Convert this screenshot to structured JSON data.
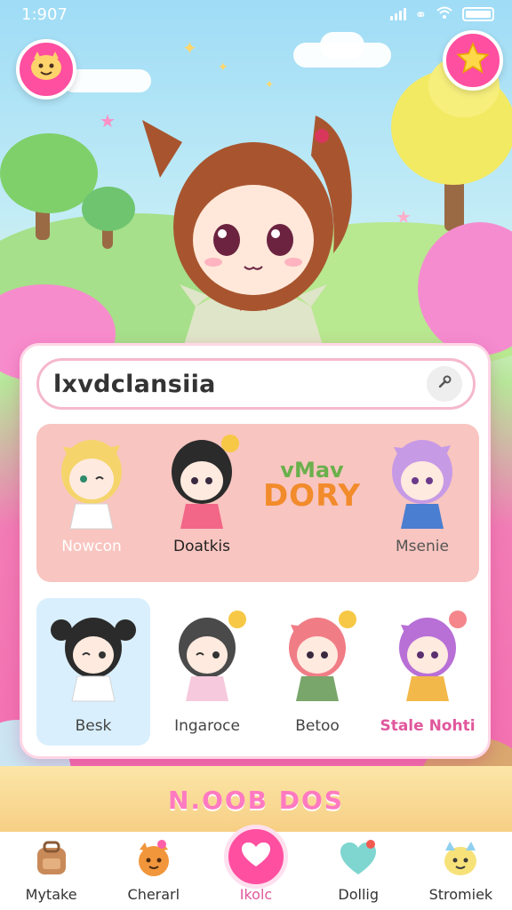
{
  "status_bar": {
    "time": "1:907"
  },
  "search": {
    "value": "lxvdclansiia"
  },
  "featured_row": [
    {
      "label": "Nowcon",
      "label_color": "#ffffff"
    },
    {
      "label": "Doatkis",
      "label_color": "#222222"
    },
    {
      "label": "",
      "logo_lines": [
        "vMav",
        "DORY"
      ]
    },
    {
      "label": "Msenie",
      "label_color": "#555555"
    }
  ],
  "character_row": [
    {
      "label": "Besk",
      "selected": true
    },
    {
      "label": "Ingaroce",
      "selected": false
    },
    {
      "label": "Betoo",
      "selected": false
    },
    {
      "label": "Stale Nohti",
      "selected": false
    }
  ],
  "banner": {
    "text": "N.OOB DOS"
  },
  "nav": [
    {
      "label": "Mytake",
      "icon": "backpack-icon"
    },
    {
      "label": "Cherarl",
      "icon": "cat-face-icon"
    },
    {
      "label": "Ikolc",
      "icon": "heart-icon",
      "active": true
    },
    {
      "label": "Dollig",
      "icon": "heart-gem-icon"
    },
    {
      "label": "Stromiek",
      "icon": "creature-icon"
    }
  ],
  "colors": {
    "accent": "#ff4fa0",
    "panel_pink": "#f8c5c0",
    "selected_blue": "#d9effd"
  }
}
